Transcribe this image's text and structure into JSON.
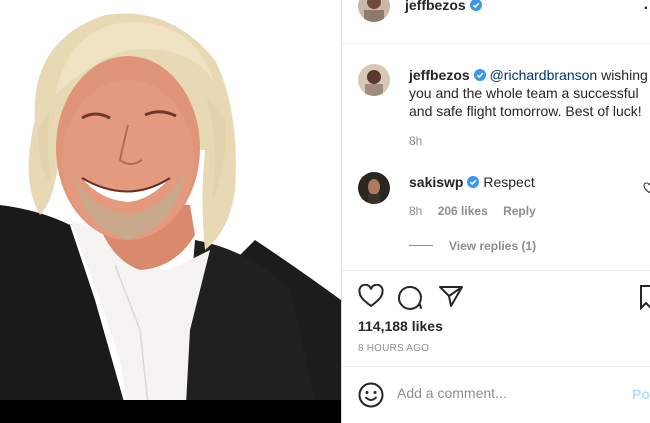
{
  "header": {
    "username": "jeffbezos",
    "more_icon": "more-options-icon"
  },
  "comments": [
    {
      "username": "jeffbezos",
      "mention": "@richardbranson",
      "text_line1": "wishing",
      "text_line2": "you and the whole team a successful",
      "text_line3": "and safe flight tomorrow. Best of luck!",
      "age": "8h"
    },
    {
      "username": "sakiswp",
      "text": "Respect",
      "age": "8h",
      "likes": "206 likes",
      "reply_label": "Reply",
      "view_replies": "View replies (1)"
    }
  ],
  "actions": {
    "like_icon": "heart-icon",
    "comment_icon": "comment-icon",
    "share_icon": "share-icon",
    "save_icon": "bookmark-icon"
  },
  "likes": "114,188 likes",
  "timestamp": "8 HOURS AGO",
  "add_comment": {
    "placeholder": "Add a comment...",
    "post_label": "Po",
    "emoji_icon": "emoji-icon"
  },
  "colors": {
    "verified": "#3897f0",
    "mention": "#00376b",
    "muted": "#8e8e8e",
    "post": "#b2dffc"
  }
}
